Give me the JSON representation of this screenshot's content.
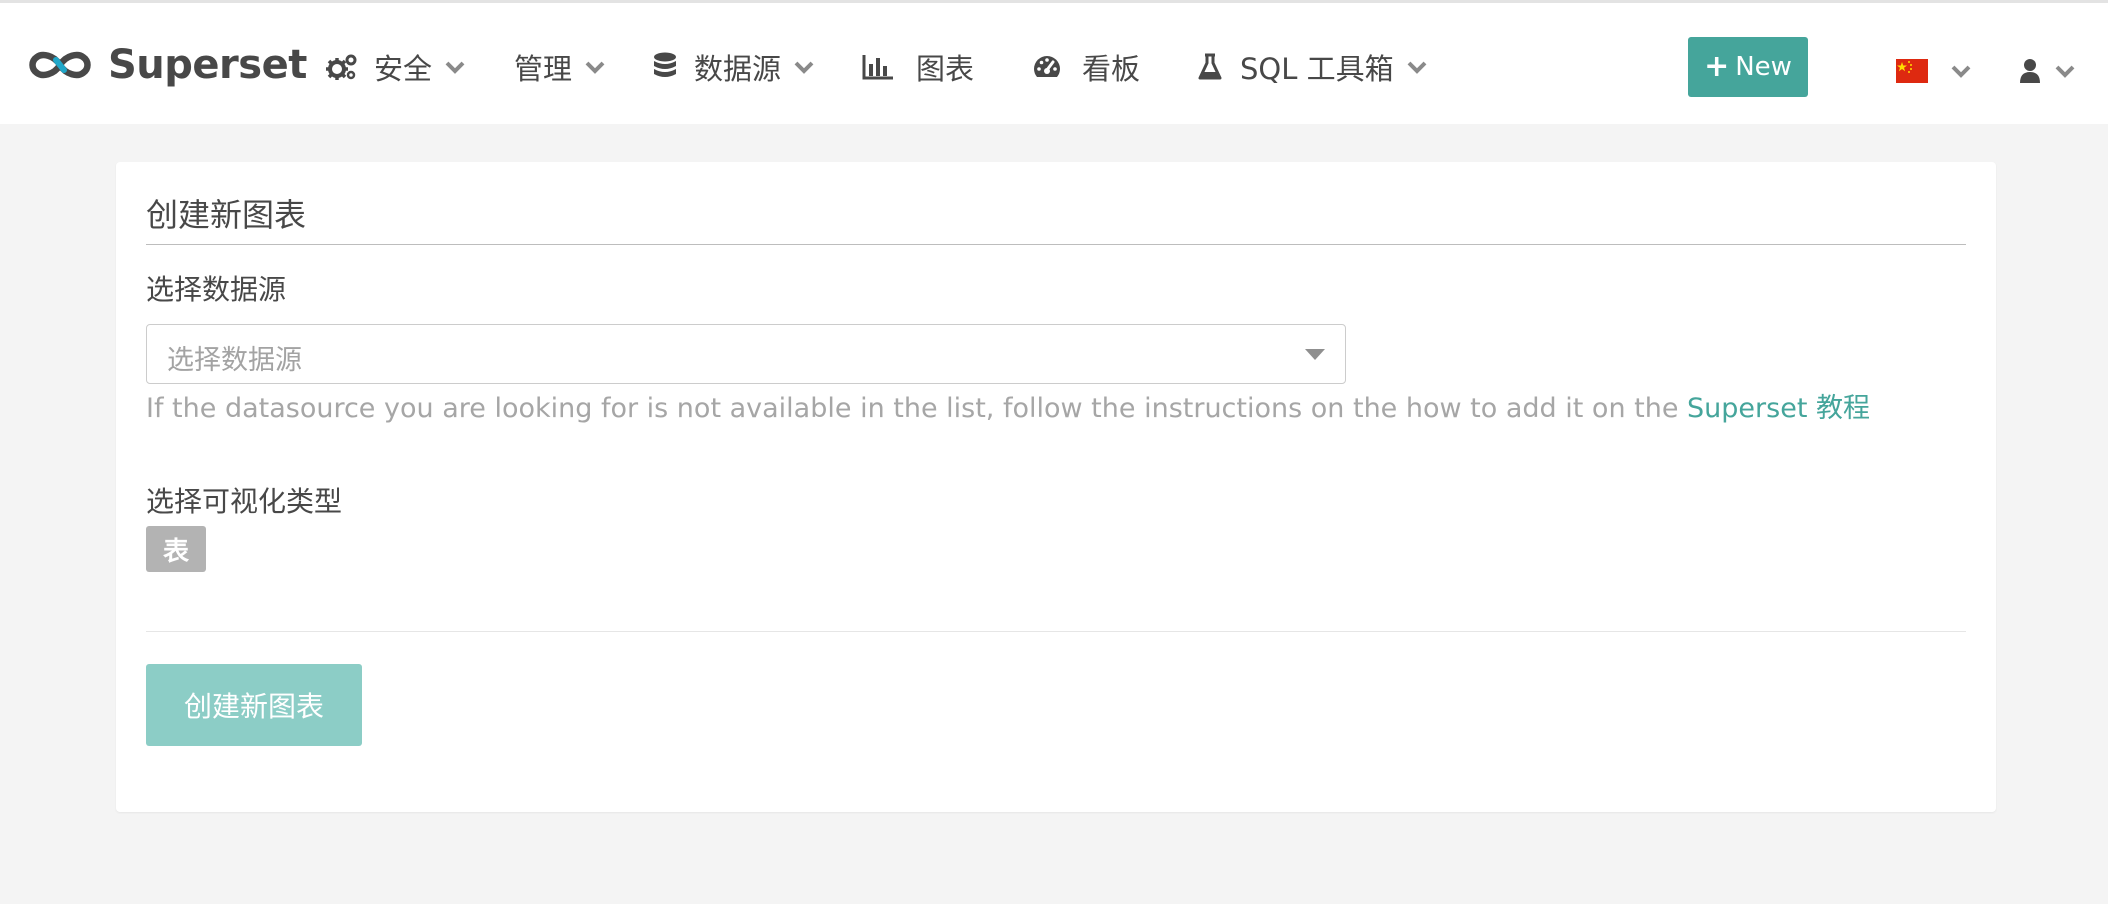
{
  "brand": {
    "name": "Superset"
  },
  "nav": {
    "security": "安全",
    "manage": "管理",
    "datasources": "数据源",
    "charts": "图表",
    "dashboards": "看板",
    "sqllab": "SQL 工具箱"
  },
  "new_button": {
    "label": "New"
  },
  "colors": {
    "accent": "#45a59b",
    "accent_light": "#8ccdc6",
    "tag_gray": "#b3b3b3"
  },
  "form": {
    "title": "创建新图表",
    "datasource_label": "选择数据源",
    "datasource_placeholder": "选择数据源",
    "help_text": "If the datasource you are looking for is not available in the list, follow the instructions on the how to add it on the ",
    "help_link": "Superset 教程",
    "viz_label": "选择可视化类型",
    "viz_selected": "表",
    "submit_label": "创建新图表"
  }
}
